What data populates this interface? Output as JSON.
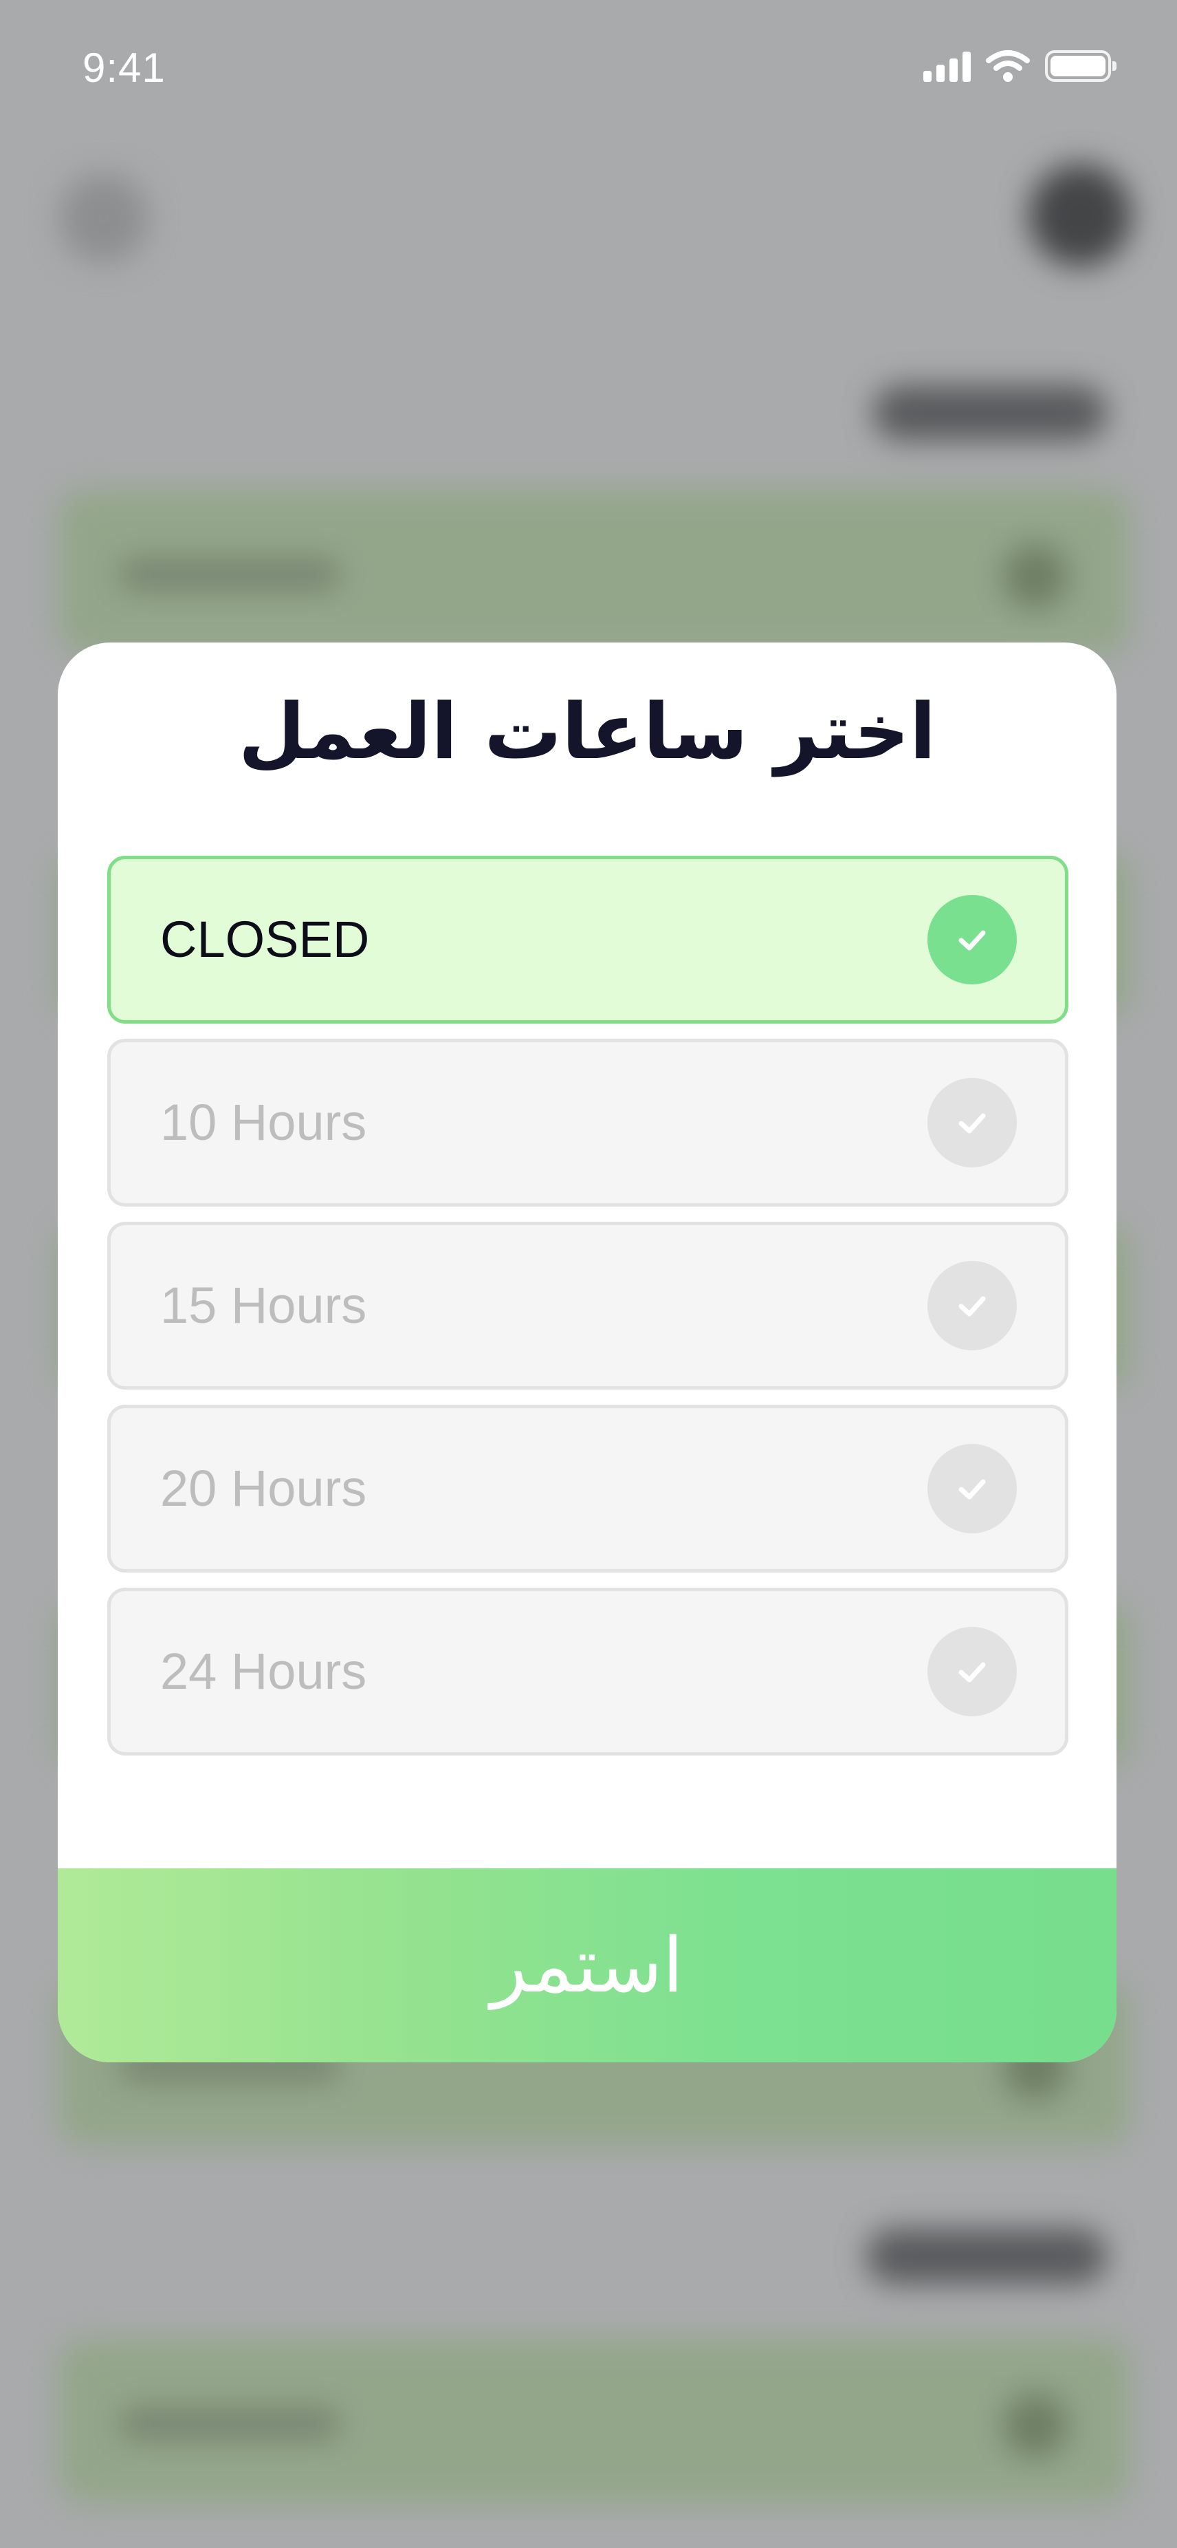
{
  "status_bar": {
    "time": "9:41",
    "icons": [
      "signal-icon",
      "wifi-icon",
      "battery-icon"
    ]
  },
  "dialog": {
    "title": "اختر ساعات العمل",
    "options": [
      {
        "label": "CLOSED",
        "selected": true
      },
      {
        "label": "10 Hours",
        "selected": false
      },
      {
        "label": "15 Hours",
        "selected": false
      },
      {
        "label": "20 Hours",
        "selected": false
      },
      {
        "label": "24 Hours",
        "selected": false
      }
    ],
    "continue_label": "استمر"
  },
  "colors": {
    "selected_border": "#80de88",
    "selected_background": "#e1fcd7",
    "unselected_background": "#f5f5f5",
    "check_selected": "#79e090",
    "check_unselected": "#e2e2e2",
    "button_gradient_start": "#b0ea98",
    "button_gradient_end": "#77de8e",
    "title_color": "#14142b"
  }
}
